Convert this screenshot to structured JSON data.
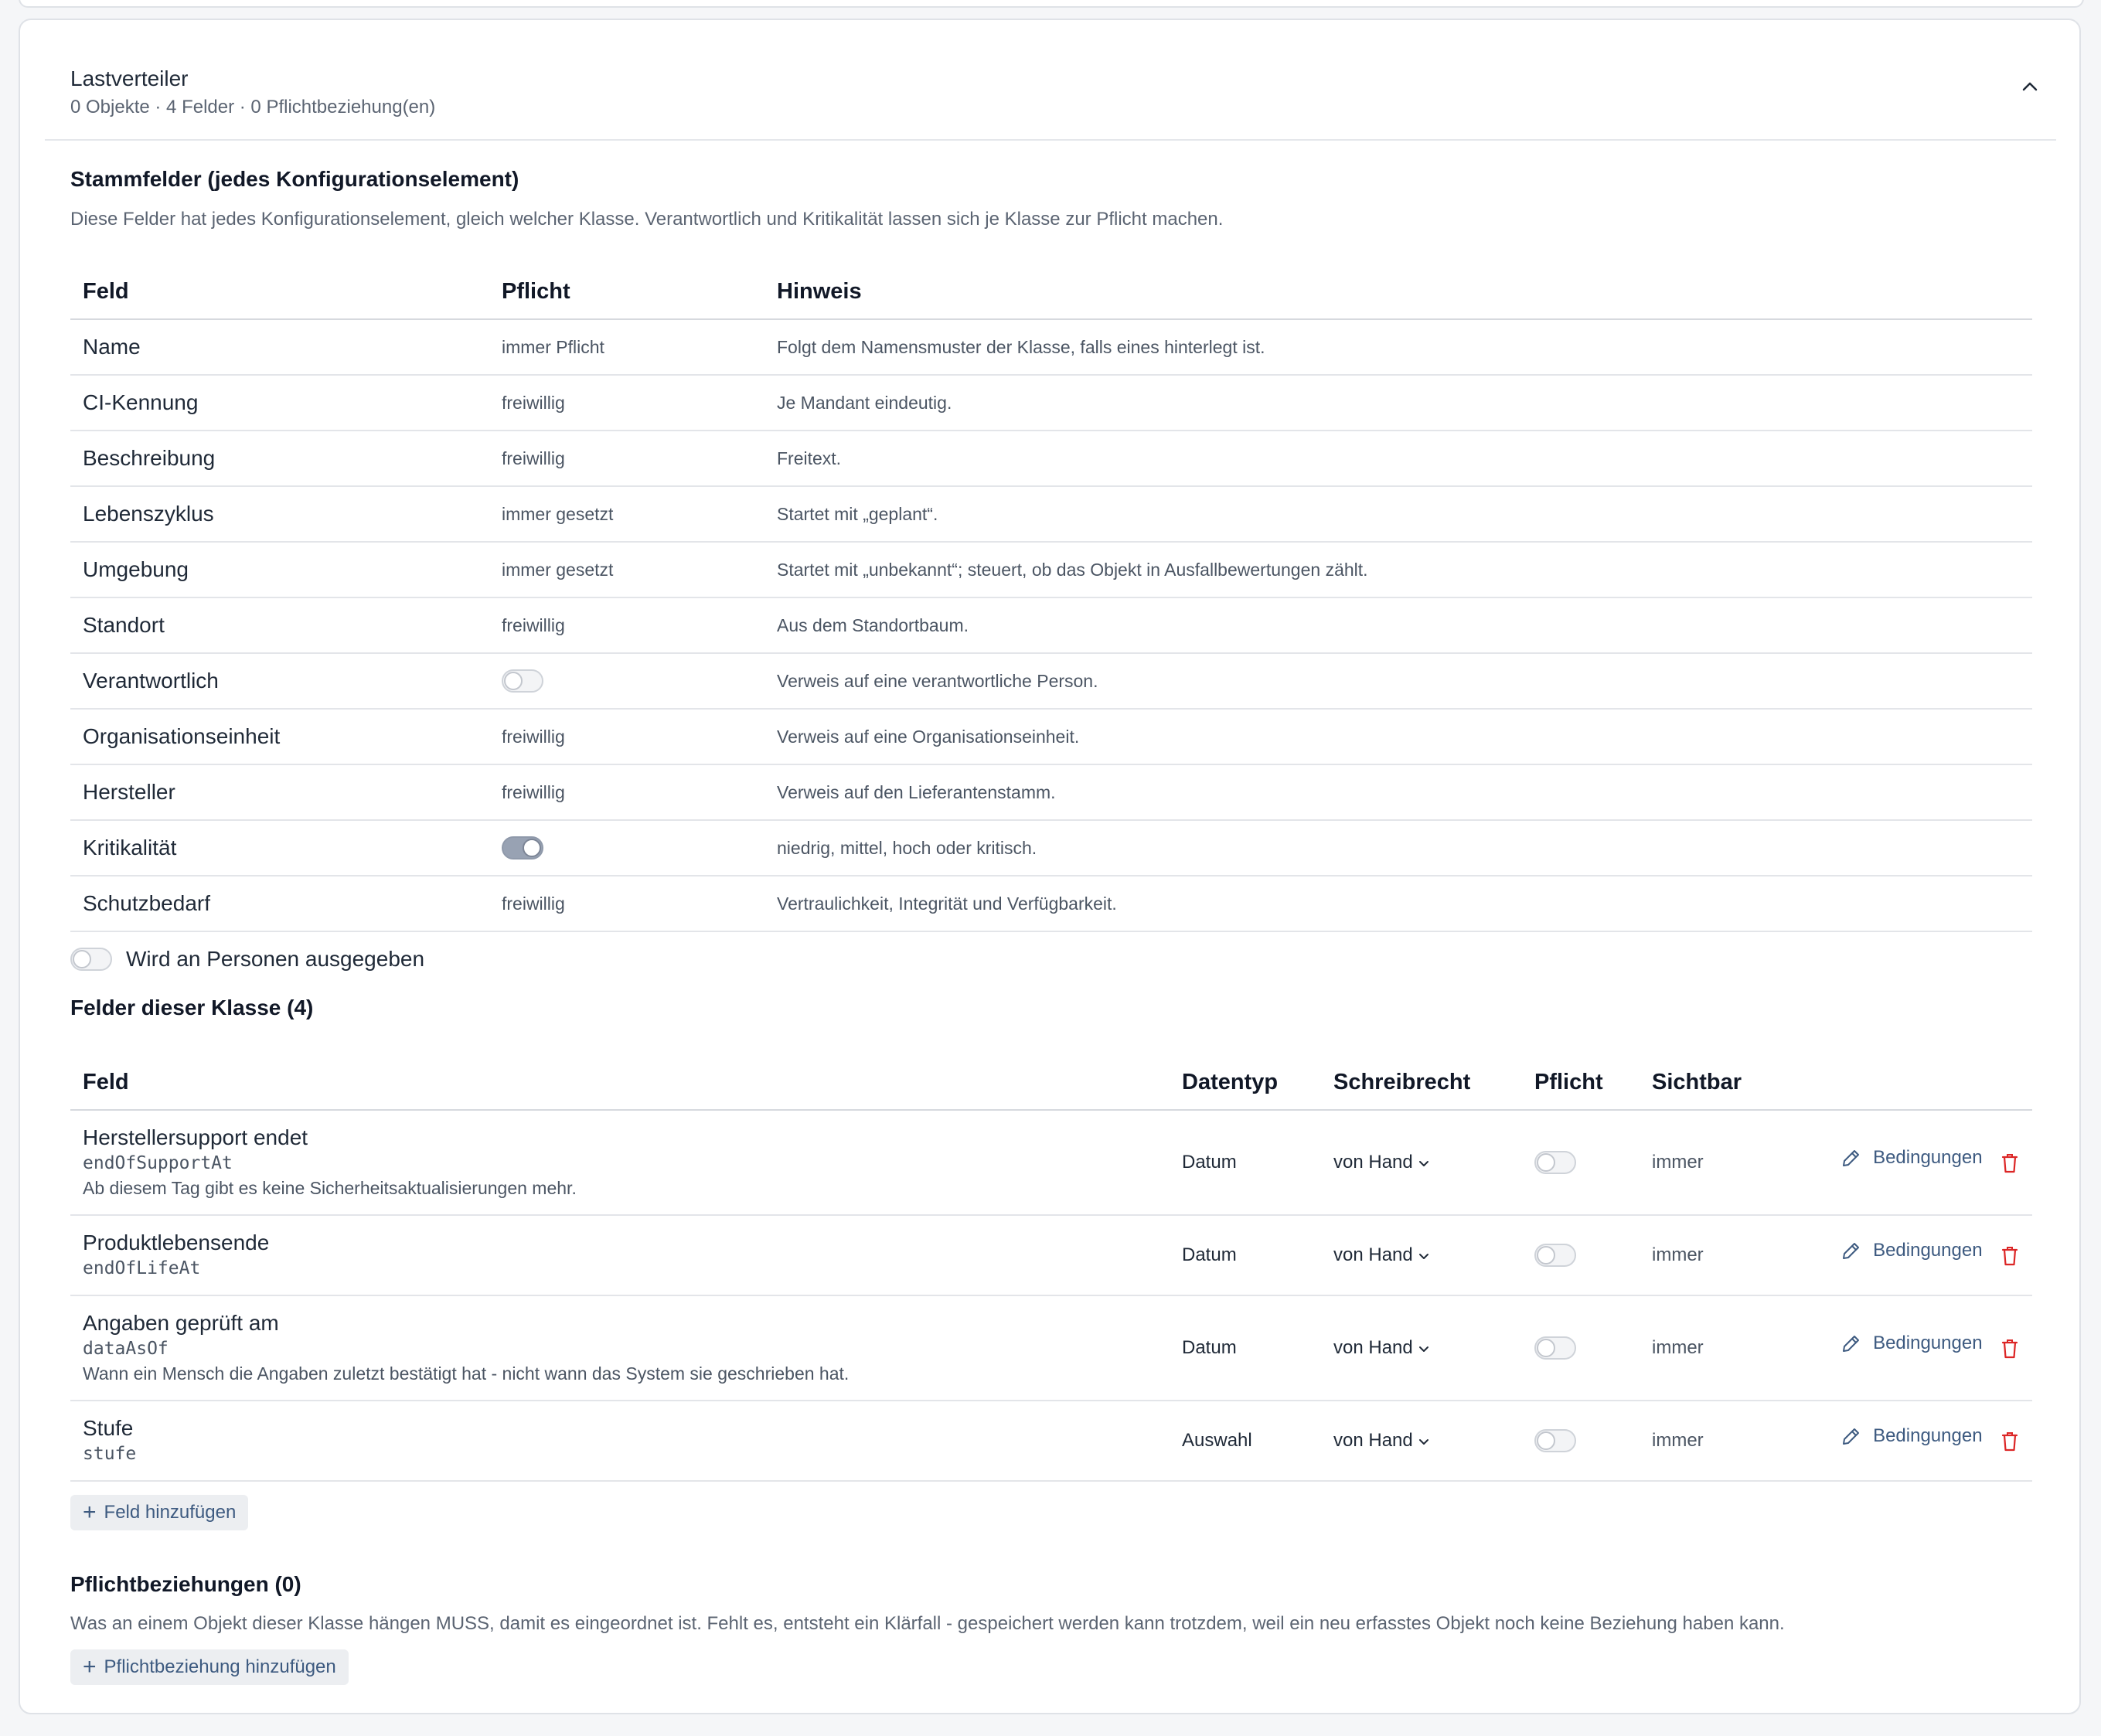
{
  "card": {
    "title": "Lastverteiler",
    "subtitle": "0 Objekte · 4 Felder · 0 Pflichtbeziehung(en)"
  },
  "base_fields": {
    "title": "Stammfelder (jedes Konfigurationselement)",
    "description": "Diese Felder hat jedes Konfigurationselement, gleich welcher Klasse. Verantwortlich und Kritikalität lassen sich je Klasse zur Pflicht machen.",
    "columns": [
      "Feld",
      "Pflicht",
      "Hinweis"
    ],
    "rows": [
      {
        "field": "Name",
        "required": "immer Pflicht",
        "hint": "Folgt dem Namensmuster der Klasse, falls eines hinterlegt ist."
      },
      {
        "field": "CI-Kennung",
        "required": "freiwillig",
        "hint": "Je Mandant eindeutig."
      },
      {
        "field": "Beschreibung",
        "required": "freiwillig",
        "hint": "Freitext."
      },
      {
        "field": "Lebenszyklus",
        "required": "immer gesetzt",
        "hint": "Startet mit „geplant“."
      },
      {
        "field": "Umgebung",
        "required": "immer gesetzt",
        "hint": "Startet mit „unbekannt“; steuert, ob das Objekt in Ausfallbewertungen zählt."
      },
      {
        "field": "Standort",
        "required": "freiwillig",
        "hint": "Aus dem Standortbaum."
      },
      {
        "field": "Verantwortlich",
        "required_toggle": false,
        "hint": "Verweis auf eine verantwortliche Person."
      },
      {
        "field": "Organisationseinheit",
        "required": "freiwillig",
        "hint": "Verweis auf eine Organisationseinheit."
      },
      {
        "field": "Hersteller",
        "required": "freiwillig",
        "hint": "Verweis auf den Lieferantenstamm."
      },
      {
        "field": "Kritikalität",
        "required_toggle": true,
        "hint": "niedrig, mittel, hoch oder kritisch."
      },
      {
        "field": "Schutzbedarf",
        "required": "freiwillig",
        "hint": "Vertraulichkeit, Integrität und Verfügbarkeit."
      }
    ],
    "issued_to_persons": {
      "label": "Wird an Personen ausgegeben",
      "on": false
    }
  },
  "class_fields": {
    "title": "Felder dieser Klasse (4)",
    "columns": [
      "Feld",
      "Datentyp",
      "Schreibrecht",
      "Pflicht",
      "Sichtbar"
    ],
    "rows": [
      {
        "name": "Herstellersupport endet",
        "key": "endOfSupportAt",
        "description": "Ab diesem Tag gibt es keine Sicherheitsaktualisierungen mehr.",
        "datatype": "Datum",
        "write": "von Hand",
        "required": false,
        "visible": "immer",
        "conditions": "Bedingungen"
      },
      {
        "name": "Produktlebensende",
        "key": "endOfLifeAt",
        "description": "",
        "datatype": "Datum",
        "write": "von Hand",
        "required": false,
        "visible": "immer",
        "conditions": "Bedingungen"
      },
      {
        "name": "Angaben geprüft am",
        "key": "dataAsOf",
        "description": "Wann ein Mensch die Angaben zuletzt bestätigt hat - nicht wann das System sie geschrieben hat.",
        "datatype": "Datum",
        "write": "von Hand",
        "required": false,
        "visible": "immer",
        "conditions": "Bedingungen"
      },
      {
        "name": "Stufe",
        "key": "stufe",
        "description": "",
        "datatype": "Auswahl",
        "write": "von Hand",
        "required": false,
        "visible": "immer",
        "conditions": "Bedingungen"
      }
    ],
    "add_label": "Feld hinzufügen"
  },
  "relations": {
    "title": "Pflichtbeziehungen (0)",
    "description": "Was an einem Objekt dieser Klasse hängen MUSS, damit es eingeordnet ist. Fehlt es, entsteht ein Klärfall - gespeichert werden kann trotzdem, weil ein neu erfasstes Objekt noch keine Beziehung haben kann.",
    "add_label": "Pflichtbeziehung hinzufügen"
  },
  "icons": {
    "collapse": "chevron-up-icon",
    "dropdown": "chevron-down-icon",
    "edit": "pencil-icon",
    "delete": "trash-icon",
    "add": "plus-icon"
  },
  "colors": {
    "accent": "#3d5a80",
    "danger": "#dc2626",
    "border": "#dfe2e7"
  }
}
